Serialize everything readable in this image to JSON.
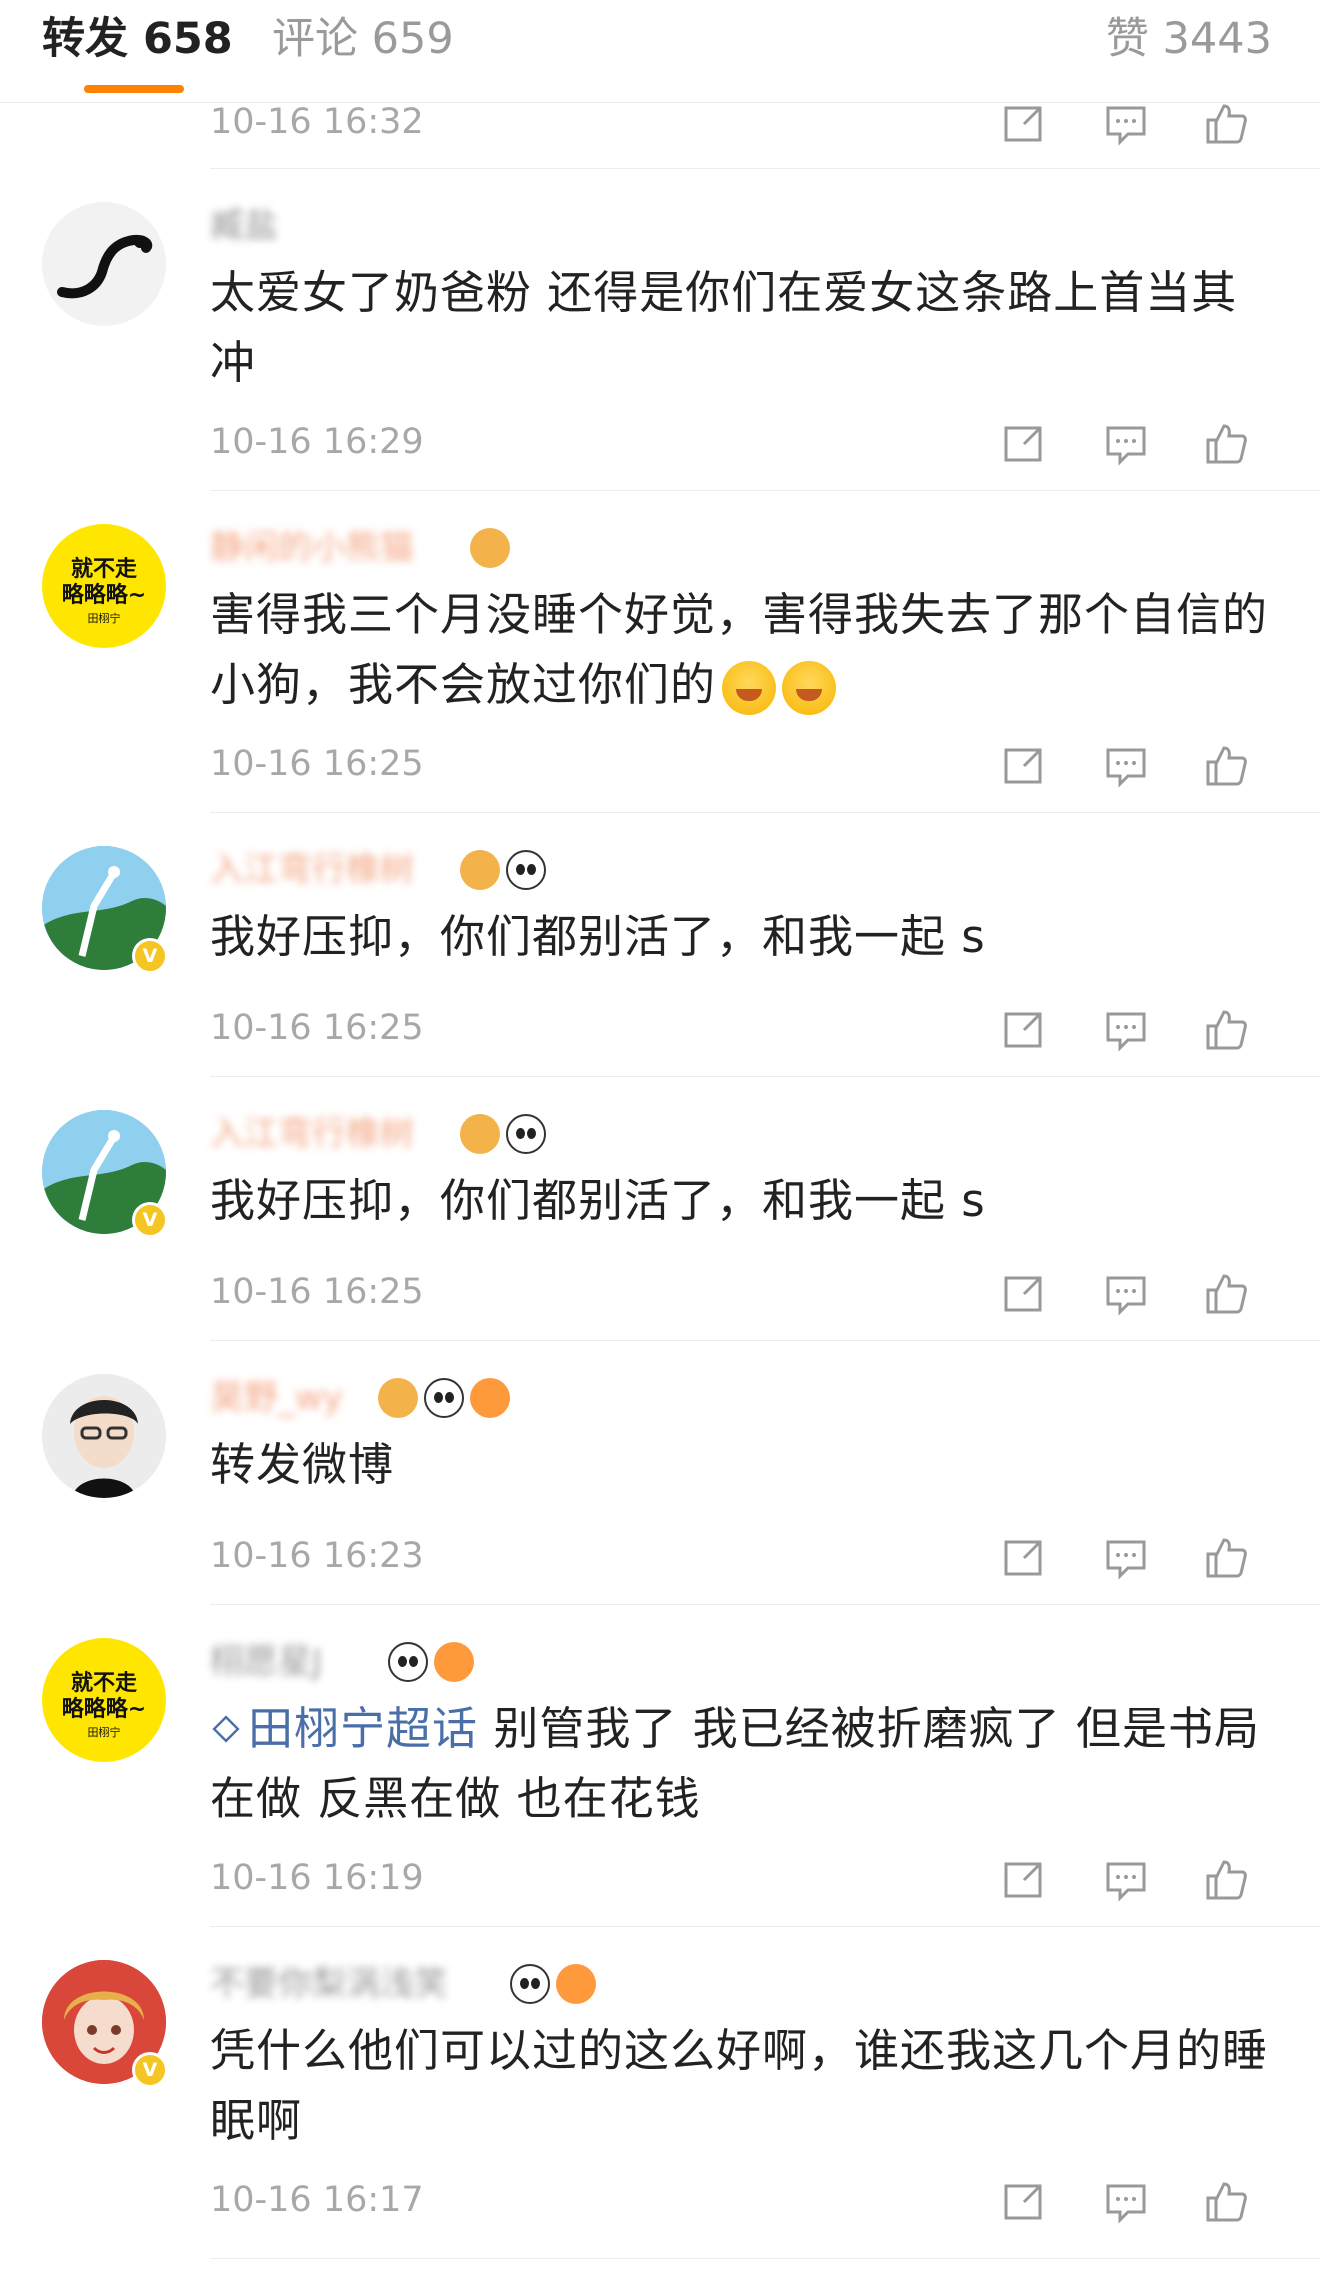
{
  "tabs": {
    "repost": "转发 658",
    "comment": "评论 659",
    "like": "赞 3443"
  },
  "top_partial": {
    "time": "10-16 16:32"
  },
  "comments": [
    {
      "username": "臧盐",
      "badges": [],
      "text": "太爱女了奶爸粉 还得是你们在爱女这条路上首当其冲",
      "time": "10-16 16:29"
    },
    {
      "username": "静闲的小熊猫",
      "badges": [
        "crown-badge"
      ],
      "text": "害得我三个月没睡个好觉，害得我失去了那个自信的小狗，我不会放过你们的",
      "emojis": [
        "smile-emoji",
        "smile-emoji"
      ],
      "time": "10-16 16:25"
    },
    {
      "username": "入江弯行橡树",
      "badges": [
        "crown-badge",
        "panda-badge"
      ],
      "text": "我好压抑，你们都别活了，和我一起 s",
      "time": "10-16 16:25",
      "verified": "V"
    },
    {
      "username": "入江弯行橡树",
      "badges": [
        "crown-badge",
        "panda-badge"
      ],
      "text": "我好压抑，你们都别活了，和我一起 s",
      "time": "10-16 16:25",
      "verified": "V"
    },
    {
      "username": "昊野_wy",
      "badges": [
        "crown-badge",
        "panda-badge",
        "fish-badge"
      ],
      "text": "转发微博",
      "time": "10-16 16:23"
    },
    {
      "username": "栩愿星J",
      "badges": [
        "panda-badge",
        "fish-badge"
      ],
      "topic": "田栩宁超话",
      "text": "别管我了 我已经被折磨疯了 但是书局在做 反黑在做 也在花钱",
      "time": "10-16 16:19"
    },
    {
      "username": "不要你梨涡浅笑",
      "badges": [
        "panda-badge",
        "fish-badge"
      ],
      "text": "凭什么他们可以过的这么好啊，谁还我这几个月的睡眠啊",
      "time": "10-16 16:17",
      "verified": "V"
    }
  ],
  "avatar_texts": {
    "yellow_line1": "就不走",
    "yellow_line2": "略略略~",
    "yellow_small": "田栩宁"
  },
  "colors": {
    "accent": "#ff8200",
    "topic": "#4a6fa8",
    "time": "#a8a8a8"
  }
}
